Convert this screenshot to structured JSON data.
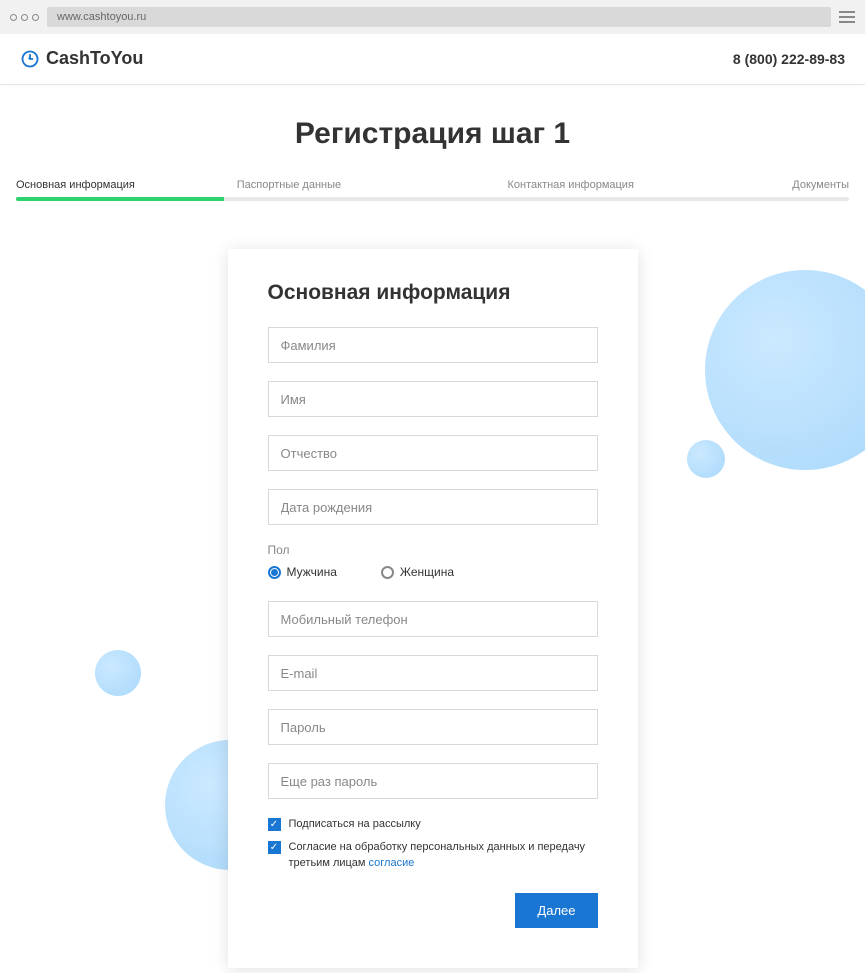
{
  "browser": {
    "url": "www.cashtoyou.ru"
  },
  "header": {
    "brand": "CashToYou",
    "phone": "8 (800) 222-89-83"
  },
  "page": {
    "title": "Регистрация шаг 1"
  },
  "steps": {
    "s1": "Основная информация",
    "s2": "Паспортные данные",
    "s3": "Контактная информация",
    "s4": "Документы"
  },
  "form": {
    "title": "Основная информация",
    "lastname": "Фамилия",
    "firstname": "Имя",
    "patronymic": "Отчество",
    "birthdate": "Дата рождения",
    "gender_label": "Пол",
    "gender_male": "Мужчина",
    "gender_female": "Женщина",
    "phone": "Мобильный телефон",
    "email": "E-mail",
    "password": "Пароль",
    "password2": "Еще раз пароль",
    "subscribe": "Подписаться на рассылку",
    "consent_text": "Согласие на обработку персональных данных и передачу третьим лицам ",
    "consent_link": "согласие",
    "submit": "Далее"
  }
}
